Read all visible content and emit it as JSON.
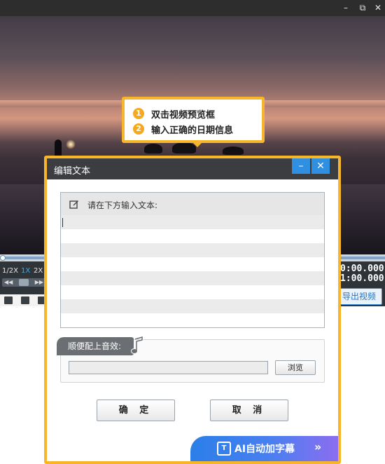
{
  "window": {
    "minimize_glyph": "–",
    "maximize_glyph": "⧉",
    "close_glyph": "✕"
  },
  "callout": {
    "steps": [
      {
        "num": "1",
        "text": "双击视频预览框"
      },
      {
        "num": "2",
        "text": "输入正确的日期信息"
      }
    ]
  },
  "controls": {
    "speeds": [
      "1/2X",
      "1X",
      "2X"
    ],
    "active_speed": "1X",
    "times": [
      "0:00.000",
      "1:00.000"
    ],
    "export_label": "导出视频"
  },
  "dialog": {
    "title": "编辑文本",
    "minimize_glyph": "–",
    "close_glyph": "✕",
    "text_label": "请在下方输入文本:",
    "text_value": "",
    "sfx_label": "顺便配上音效:",
    "sfx_value": "",
    "browse_label": "浏览",
    "ok_label": "确 定",
    "cancel_label": "取 消",
    "ai_banner": "AI自动加字幕",
    "ai_arrow": "»",
    "ai_icon_text": "T"
  },
  "colors": {
    "accent_orange": "#f7b52b",
    "accent_blue": "#2f8fe0",
    "title_bar": "#3b3d41"
  },
  "icons": [
    "edit-icon",
    "music-note-icon",
    "subtitle-icon",
    "minimize-icon",
    "close-icon"
  ]
}
